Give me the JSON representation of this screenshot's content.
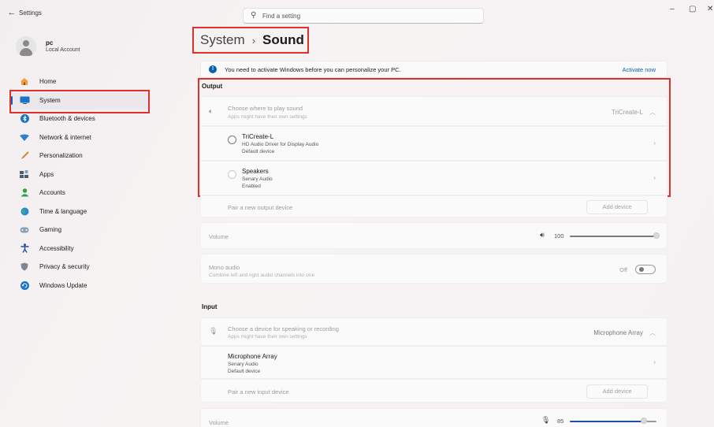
{
  "window": {
    "title": "Settings",
    "controls": {
      "minimize": "–",
      "restore": "▢",
      "close": "✕"
    }
  },
  "search": {
    "placeholder": "Find a setting"
  },
  "profile": {
    "name": "pc",
    "account_type": "Local Account"
  },
  "sidebar": {
    "items": [
      {
        "label": "Home",
        "icon": "home-icon"
      },
      {
        "label": "System",
        "icon": "system-icon",
        "active": true
      },
      {
        "label": "Bluetooth & devices",
        "icon": "bluetooth-icon"
      },
      {
        "label": "Network & internet",
        "icon": "network-icon"
      },
      {
        "label": "Personalization",
        "icon": "brush-icon"
      },
      {
        "label": "Apps",
        "icon": "apps-icon"
      },
      {
        "label": "Accounts",
        "icon": "accounts-icon"
      },
      {
        "label": "Time & language",
        "icon": "globe-icon"
      },
      {
        "label": "Gaming",
        "icon": "gamepad-icon"
      },
      {
        "label": "Accessibility",
        "icon": "accessibility-icon"
      },
      {
        "label": "Privacy & security",
        "icon": "shield-icon"
      },
      {
        "label": "Windows Update",
        "icon": "update-icon"
      }
    ]
  },
  "breadcrumb": {
    "parent": "System",
    "separator": "›",
    "current": "Sound"
  },
  "activation_banner": {
    "message": "You need to activate Windows before you can personalize your PC.",
    "action": "Activate now"
  },
  "output": {
    "section_label": "Output",
    "choose": {
      "title": "Choose where to play sound",
      "subtitle": "Apps might have their own settings",
      "value": "TriCreate-L"
    },
    "devices": [
      {
        "name": "TriCreate-L",
        "driver": "HD Audio Driver for Display Audio",
        "status": "Default device"
      },
      {
        "name": "Speakers",
        "driver": "Senary Audio",
        "status": "Enabled"
      }
    ],
    "pair": {
      "label": "Pair a new output device",
      "button": "Add device"
    },
    "volume": {
      "label": "Volume",
      "value": "100",
      "level": 1.0
    },
    "mono": {
      "title": "Mono audio",
      "subtitle": "Combine left and right audio channels into one",
      "state": "Off"
    }
  },
  "input": {
    "section_label": "Input",
    "choose": {
      "title": "Choose a device for speaking or recording",
      "subtitle": "Apps might have their own settings",
      "value": "Microphone Array"
    },
    "devices": [
      {
        "name": "Microphone Array",
        "driver": "Senary Audio",
        "status": "Default device"
      }
    ],
    "pair": {
      "label": "Pair a new input device",
      "button": "Add device"
    },
    "volume": {
      "label": "Volume",
      "value": "85",
      "level": 0.85
    }
  },
  "colors": {
    "accent": "#0067c0",
    "highlight": "#e0302a"
  }
}
